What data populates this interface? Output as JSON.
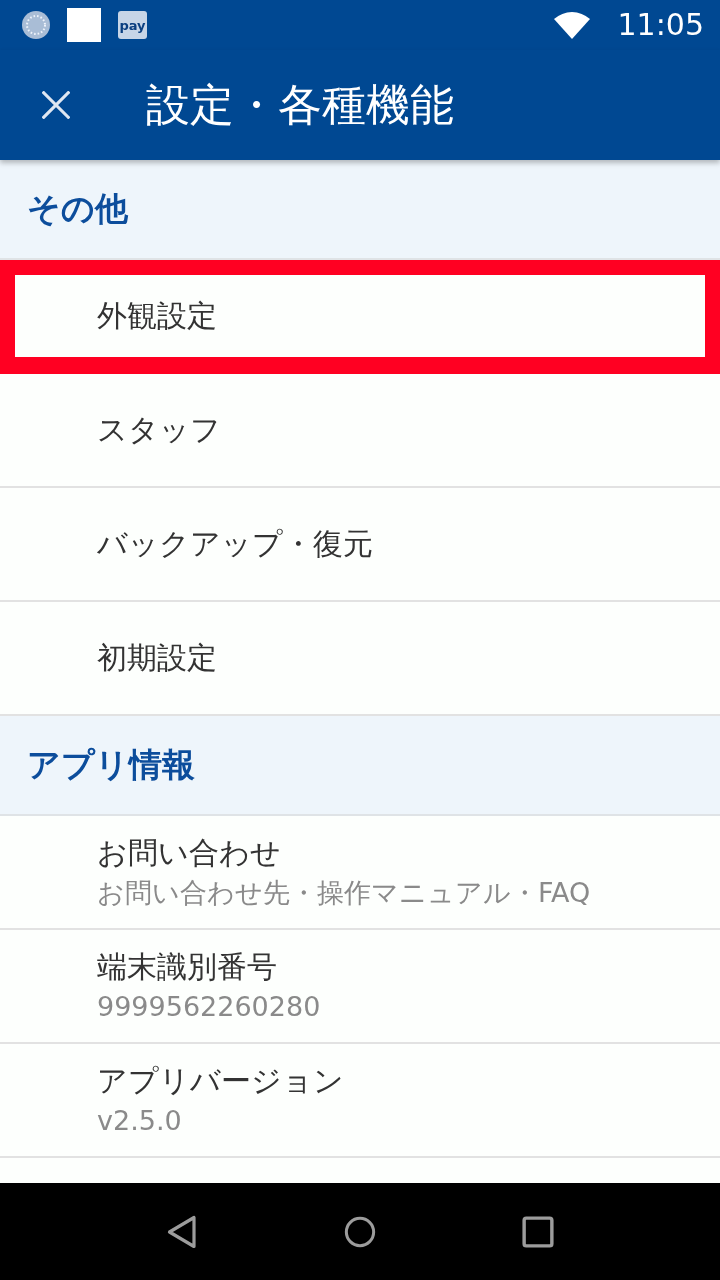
{
  "status_bar": {
    "notification_icons": [
      {
        "kind": "ring"
      },
      {
        "kind": "square"
      },
      {
        "kind": "app",
        "label": "pay"
      }
    ],
    "time": "11:05"
  },
  "app_bar": {
    "title": "設定・各種機能"
  },
  "sections": [
    {
      "title": "その他",
      "items": [
        {
          "label": "外観設定",
          "highlighted": true
        },
        {
          "label": "スタッフ",
          "highlighted": false
        },
        {
          "label": "バックアップ・復元",
          "highlighted": false
        },
        {
          "label": "初期設定",
          "highlighted": false
        }
      ]
    },
    {
      "title": "アプリ情報",
      "items": [
        {
          "label": "お問い合わせ",
          "sublabel": "お問い合わせ先・操作マニュアル・FAQ",
          "highlighted": false
        },
        {
          "label": "端末識別番号",
          "sublabel": "9999562260280",
          "highlighted": false
        },
        {
          "label": "アプリバージョン",
          "sublabel": "v2.5.0",
          "highlighted": false
        }
      ]
    }
  ]
}
